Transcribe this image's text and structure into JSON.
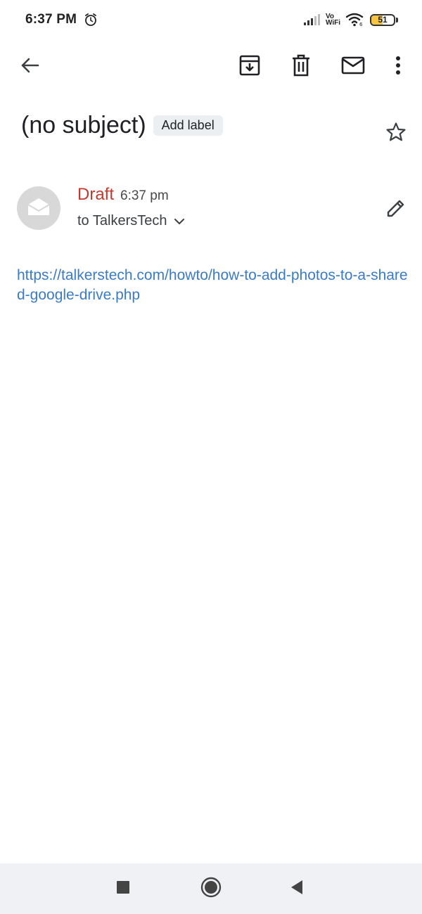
{
  "status_bar": {
    "time": "6:37 PM",
    "vo": "Vo",
    "wifi_label": "WiFi",
    "battery_level": "51",
    "battery_fraction": 0.51,
    "icons": [
      "alarm-icon",
      "signal-icon",
      "wifi-icon",
      "battery-icon"
    ]
  },
  "toolbar": {
    "icons": [
      "back-arrow-icon",
      "archive-icon",
      "delete-icon",
      "mark-unread-icon",
      "more-vert-icon"
    ]
  },
  "email": {
    "subject": "(no subject)",
    "add_label": "Add label",
    "sender_status": "Draft",
    "time": "6:37 pm",
    "recipient": "to TalkersTech",
    "body_link": "https://talkerstech.com/howto/how-to-add-photos-to-a-shared-google-drive.php"
  },
  "colors": {
    "draft": "#c5392f",
    "link": "#3a7bc8",
    "label_chip_bg": "#eceff1",
    "nav_bar_bg": "#f0f1f5"
  },
  "nav_bar": {
    "icons": [
      "recents-square-icon",
      "home-circle-icon",
      "back-triangle-icon"
    ]
  }
}
